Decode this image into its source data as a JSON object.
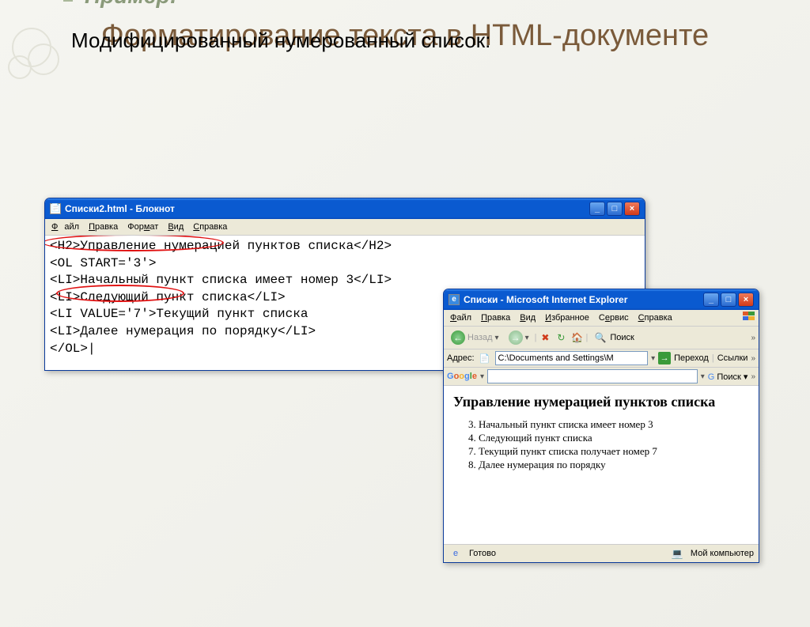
{
  "slide": {
    "title": "Форматирование текста в HTML-документе",
    "example_label": "Пример:",
    "subtitle": "Модифицированный нумерованный список:"
  },
  "notepad": {
    "title": "Списки2.html - Блокнот",
    "menu": {
      "file": "Файл",
      "edit": "Правка",
      "format": "Формат",
      "view": "Вид",
      "help": "Справка"
    },
    "code": {
      "l1": "<H2>Управление нумерацией пунктов списка</H2>",
      "l2": "<OL START='3'>",
      "l3": "  <LI>Начальный пункт списка имеет номер 3</LI>",
      "l4": "  <LI>Следующий пункт списка</LI>",
      "l5": "  <LI VALUE='7'>Текущий пункт списка",
      "l6": "  <LI>Далее нумерация по порядку</LI>",
      "l7": "</OL>|"
    }
  },
  "ie": {
    "title": "Списки - Microsoft Internet Explorer",
    "menu": {
      "file": "Файл",
      "edit": "Правка",
      "view": "Вид",
      "fav": "Избранное",
      "tools": "Сервис",
      "help": "Справка"
    },
    "nav": {
      "back": "Назад",
      "search": "Поиск"
    },
    "addr": {
      "label": "Адрес:",
      "value": "C:\\Documents and Settings\\М",
      "go": "Переход",
      "links": "Ссылки"
    },
    "google": {
      "search": "Поиск"
    },
    "page": {
      "heading": "Управление нумерацией пунктов списка",
      "items": {
        "i3": "Начальный пункт списка имеет номер 3",
        "i4": "Следующий пункт списка",
        "i7": "Текущий пункт списка получает номер 7",
        "i8": "Далее нумерация по порядку"
      }
    },
    "status": {
      "ready": "Готово",
      "zone": "Мой компьютер"
    }
  }
}
